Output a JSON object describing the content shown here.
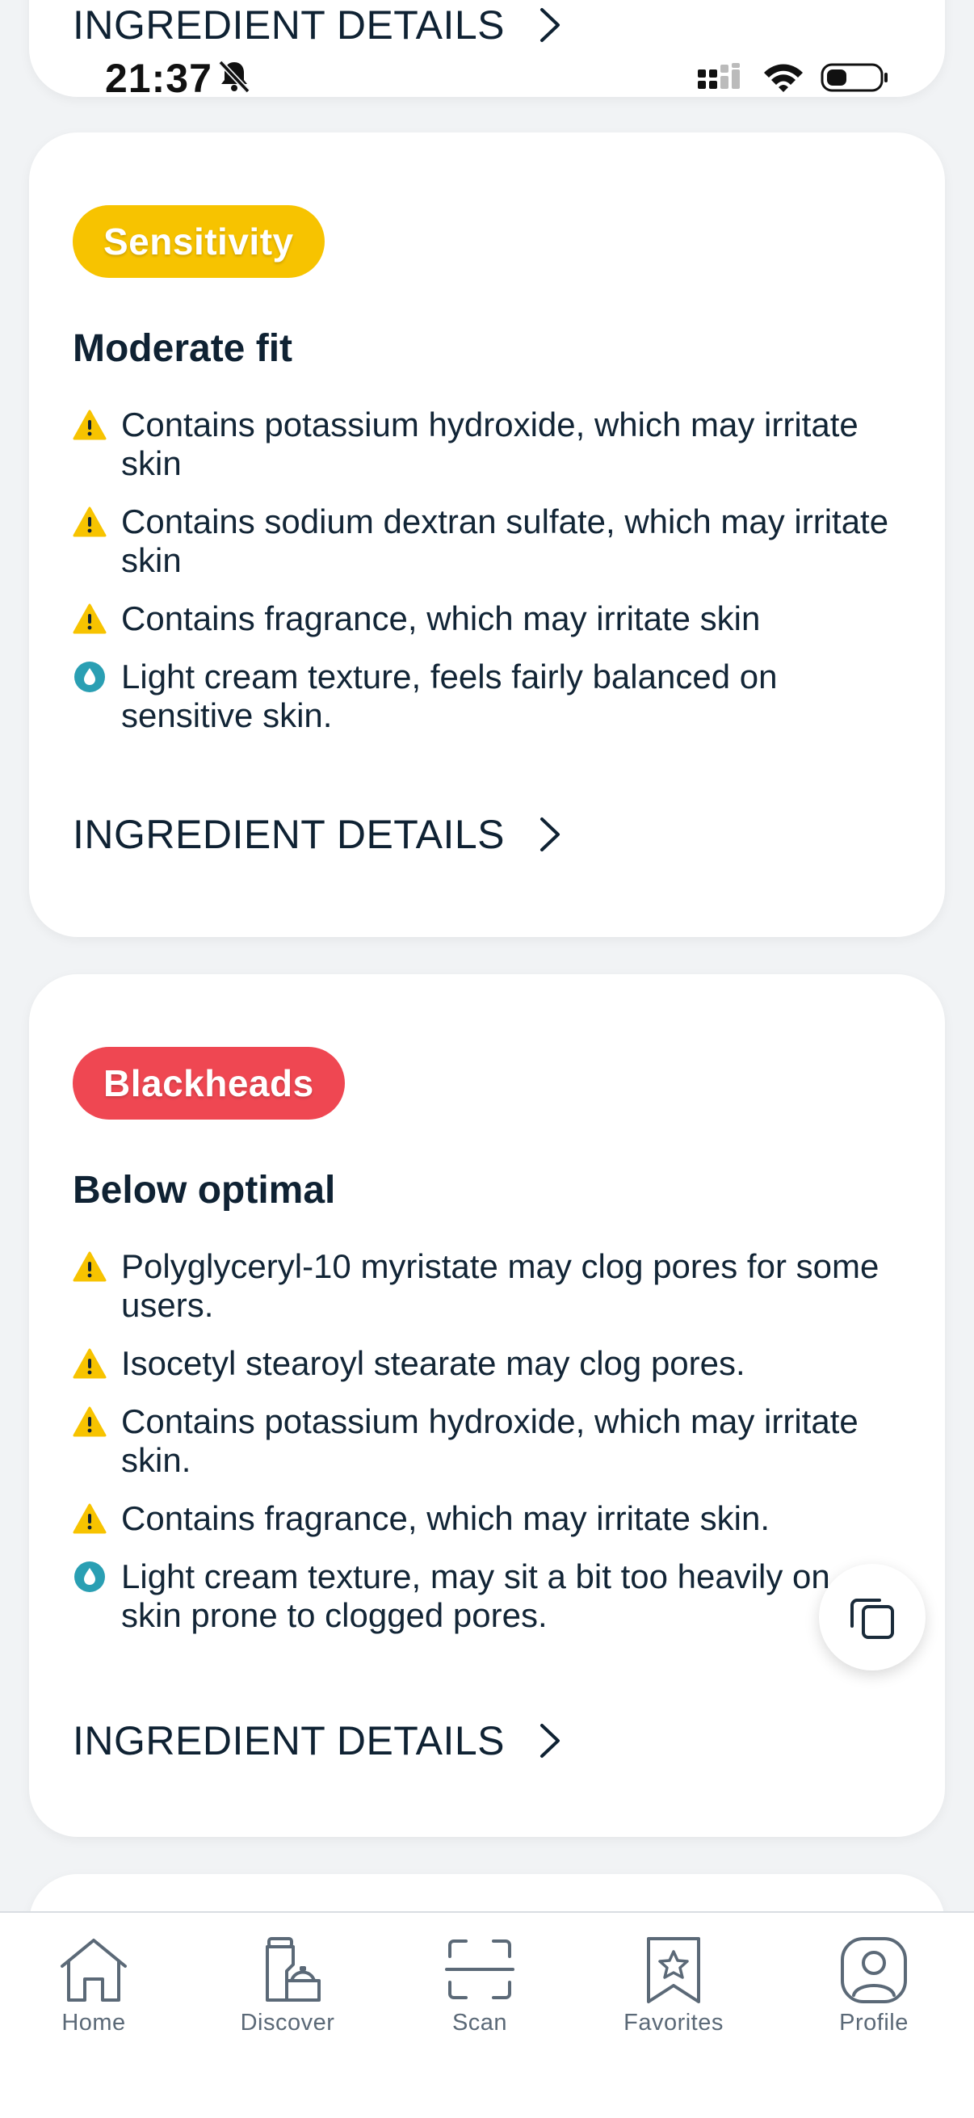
{
  "status_bar": {
    "time": "21:37"
  },
  "top_card": {
    "details_label": "INGREDIENT DETAILS"
  },
  "cards": [
    {
      "tag": "Sensitivity",
      "tag_color": "#f7c300",
      "fit": "Moderate fit",
      "items": [
        {
          "type": "warning",
          "text": "Contains potassium hydroxide, which may irritate skin"
        },
        {
          "type": "warning",
          "text": "Contains sodium dextran sulfate, which may irritate skin"
        },
        {
          "type": "warning",
          "text": "Contains fragrance, which may irritate skin"
        },
        {
          "type": "info",
          "text": "Light cream texture, feels fairly balanced on sensitive skin."
        }
      ],
      "details_label": "INGREDIENT DETAILS"
    },
    {
      "tag": "Blackheads",
      "tag_color": "#ef4752",
      "fit": "Below optimal",
      "items": [
        {
          "type": "warning",
          "text": "Polyglyceryl-10 myristate may clog pores for some users."
        },
        {
          "type": "warning",
          "text": "Isocetyl stearoyl stearate may clog pores."
        },
        {
          "type": "warning",
          "text": "Contains potassium hydroxide, which may irritate skin."
        },
        {
          "type": "warning",
          "text": "Contains fragrance, which may irritate skin."
        },
        {
          "type": "info",
          "text": "Light cream texture, may sit a bit too heavily on skin prone to clogged pores."
        }
      ],
      "details_label": "INGREDIENT DETAILS"
    }
  ],
  "icons": {
    "warning": "warning-icon",
    "info": "droplet-icon"
  },
  "colors": {
    "warning": "#f7c300",
    "info": "#2a9fb3",
    "text": "#102131"
  },
  "tabs": [
    {
      "label": "Home",
      "icon": "home-icon"
    },
    {
      "label": "Discover",
      "icon": "discover-icon"
    },
    {
      "label": "Scan",
      "icon": "scan-icon"
    },
    {
      "label": "Favorites",
      "icon": "favorites-icon"
    },
    {
      "label": "Profile",
      "icon": "profile-icon"
    }
  ]
}
